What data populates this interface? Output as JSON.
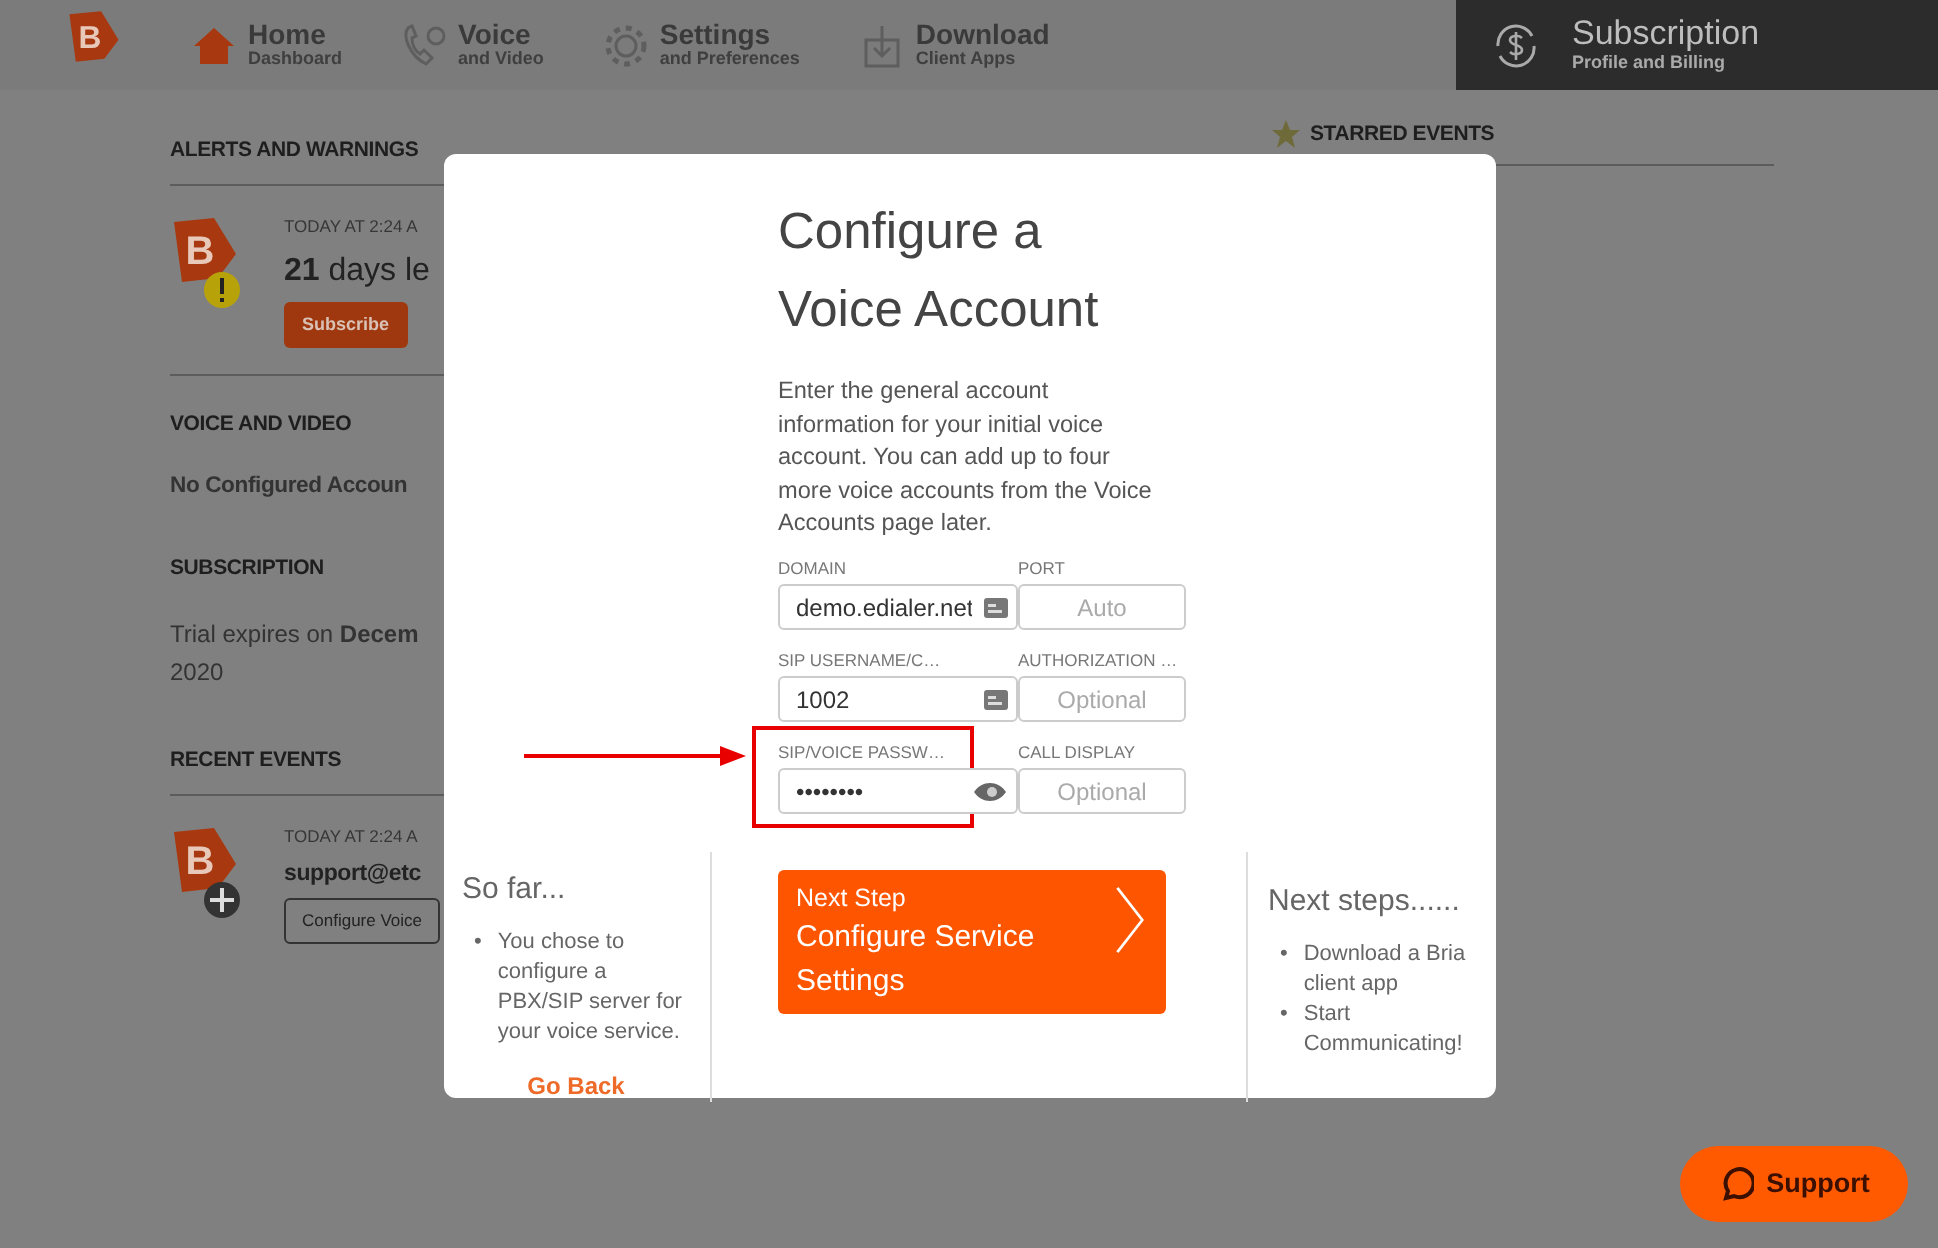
{
  "logo": {
    "letter": "B"
  },
  "nav": {
    "items": [
      {
        "label": "Home",
        "sublabel": "Dashboard",
        "selected": true
      },
      {
        "label": "Voice",
        "sublabel": "and Video",
        "selected": false
      },
      {
        "label": "Settings",
        "sublabel": "and Preferences",
        "selected": false
      },
      {
        "label": "Download",
        "sublabel": "Client Apps",
        "selected": false
      }
    ],
    "subscription": {
      "label": "Subscription",
      "sublabel": "Profile and Billing"
    }
  },
  "dashboard": {
    "alerts": {
      "heading": "ALERTS AND WARNINGS",
      "avatar_letter": "B",
      "time": "TODAY AT 2:24 A",
      "message": "**21** days le",
      "button": "Subscribe"
    },
    "voice": {
      "heading": "VOICE AND VIDEO",
      "text": "No Configured Accoun"
    },
    "subscription": {
      "heading": "SUBSCRIPTION",
      "lines": [
        "Trial expires on **Decem**",
        "2020"
      ]
    },
    "events": {
      "heading": "RECENT EVENTS",
      "avatar_letter": "B",
      "time": "TODAY AT 2:24 A",
      "title": "support@etc",
      "button": "Configure Voice"
    },
    "starred": {
      "heading": "STARRED EVENTS"
    }
  },
  "modal": {
    "title": "Configure a Voice Account",
    "description": "Enter the general account information for your initial voice account. You can add up to four more voice accounts from the Voice Accounts page later.",
    "fields": [
      [
        {
          "kind": "text",
          "label": "DOMAIN",
          "value": "demo.edialer.net",
          "highlighted": false
        },
        {
          "kind": "plain",
          "label": "PORT",
          "placeholder": "Auto",
          "highlighted": false
        }
      ],
      [
        {
          "kind": "text",
          "label": "SIP USERNAME/C…",
          "value": "1002",
          "highlighted": false
        },
        {
          "kind": "plain",
          "label": "AUTHORIZATION …",
          "placeholder": "Optional",
          "highlighted": false
        }
      ],
      [
        {
          "kind": "password",
          "label": "SIP/VOICE PASSW…",
          "value": "••••••••",
          "highlighted": true
        },
        {
          "kind": "plain",
          "label": "CALL DISPLAY",
          "placeholder": "Optional",
          "highlighted": false
        }
      ]
    ],
    "so_far": {
      "heading": "So far...",
      "items": [
        {
          "bullet": "•",
          "text": "You chose to configure a PBX/SIP server for your voice service."
        }
      ],
      "link": "Go Back"
    },
    "next_button": {
      "caption": "Next Step",
      "label": "Configure Service Settings"
    },
    "next_steps": {
      "heading": "Next steps......",
      "items": [
        {
          "bullet": "•",
          "text": "Download a Bria client app"
        },
        {
          "bullet": "•",
          "text": "Start Communicating!"
        }
      ]
    }
  },
  "support_button": {
    "label": "Support"
  }
}
